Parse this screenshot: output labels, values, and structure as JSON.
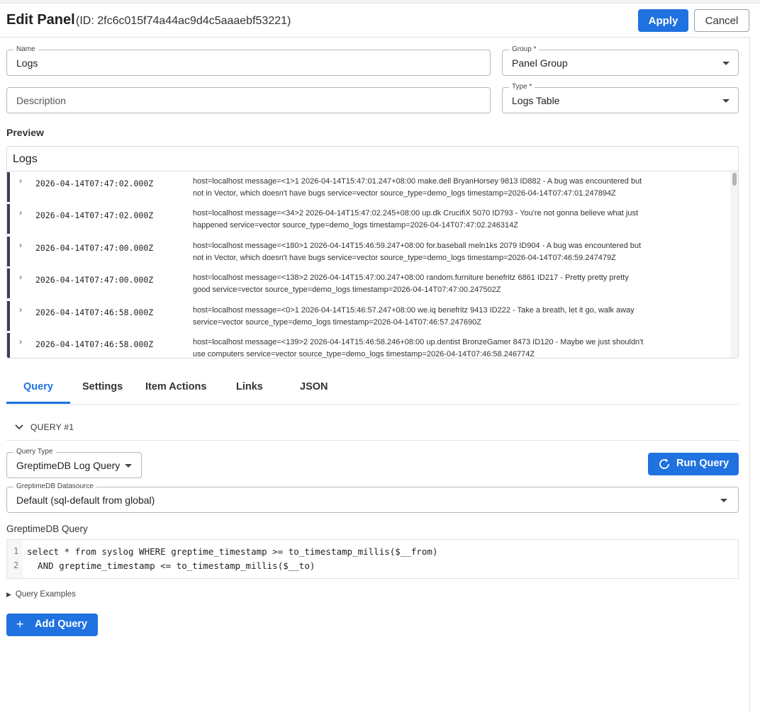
{
  "header": {
    "title": "Edit Panel",
    "id_text": "(ID: 2fc6c015f74a44ac9d4c5aaaebf53221)",
    "apply_label": "Apply",
    "cancel_label": "Cancel"
  },
  "form": {
    "name_label": "Name",
    "name_value": "Logs",
    "group_label": "Group *",
    "group_value": "Panel Group",
    "description_placeholder": "Description",
    "type_label": "Type *",
    "type_value": "Logs Table"
  },
  "preview": {
    "label": "Preview",
    "panel_title": "Logs",
    "rows": [
      {
        "ts": "2026-04-14T07:47:02.000Z",
        "line1": "host=localhost message=<1>1 2026-04-14T15:47:01.247+08:00 make.dell BryanHorsey 9813 ID882 - A bug was encountered but",
        "line2": "not in Vector, which doesn't have bugs service=vector source_type=demo_logs timestamp=2026-04-14T07:47:01.247894Z"
      },
      {
        "ts": "2026-04-14T07:47:02.000Z",
        "line1": "host=localhost message=<34>2 2026-04-14T15:47:02.245+08:00 up.dk CrucifiX 5070 ID793 - You're not gonna believe what just",
        "line2": "happened service=vector source_type=demo_logs timestamp=2026-04-14T07:47:02.246314Z"
      },
      {
        "ts": "2026-04-14T07:47:00.000Z",
        "line1": "host=localhost message=<180>1 2026-04-14T15:46:59.247+08:00 for.baseball meln1ks 2079 ID904 - A bug was encountered but",
        "line2": "not in Vector, which doesn't have bugs service=vector source_type=demo_logs timestamp=2026-04-14T07:46:59.247479Z"
      },
      {
        "ts": "2026-04-14T07:47:00.000Z",
        "line1": "host=localhost message=<138>2 2026-04-14T15:47:00.247+08:00 random.furniture benefritz 6861 ID217 - Pretty pretty pretty",
        "line2": "good service=vector source_type=demo_logs timestamp=2026-04-14T07:47:00.247502Z"
      },
      {
        "ts": "2026-04-14T07:46:58.000Z",
        "line1": "host=localhost message=<0>1 2026-04-14T15:46:57.247+08:00 we.iq benefritz 9413 ID222 - Take a breath, let it go, walk away",
        "line2": "service=vector source_type=demo_logs timestamp=2026-04-14T07:46:57.247690Z"
      },
      {
        "ts": "2026-04-14T07:46:58.000Z",
        "line1": "host=localhost message=<139>2 2026-04-14T15:46:58.246+08:00 up.dentist BronzeGamer 8473 ID120 - Maybe we just shouldn't",
        "line2": "use computers service=vector source_type=demo_logs timestamp=2026-04-14T07:46:58.246774Z"
      }
    ]
  },
  "tabs": [
    "Query",
    "Settings",
    "Item Actions",
    "Links",
    "JSON"
  ],
  "query": {
    "section_title": "QUERY #1",
    "type_label": "Query Type",
    "type_value": "GreptimeDB Log Query",
    "run_label": "Run Query",
    "datasource_label": "GreptimeDB Datasource",
    "datasource_value": "Default (sql-default from global)",
    "editor_label": "GreptimeDB Query",
    "lines": [
      {
        "num": "1",
        "text": "select * from syslog WHERE greptime_timestamp >= to_timestamp_millis($__from)"
      },
      {
        "num": "2",
        "text": "  AND greptime_timestamp <= to_timestamp_millis($__to)"
      }
    ],
    "examples_label": "Query Examples",
    "add_label": "Add Query"
  },
  "colors": {
    "primary": "#1f72e0",
    "row_bar": "#3a3f55"
  }
}
